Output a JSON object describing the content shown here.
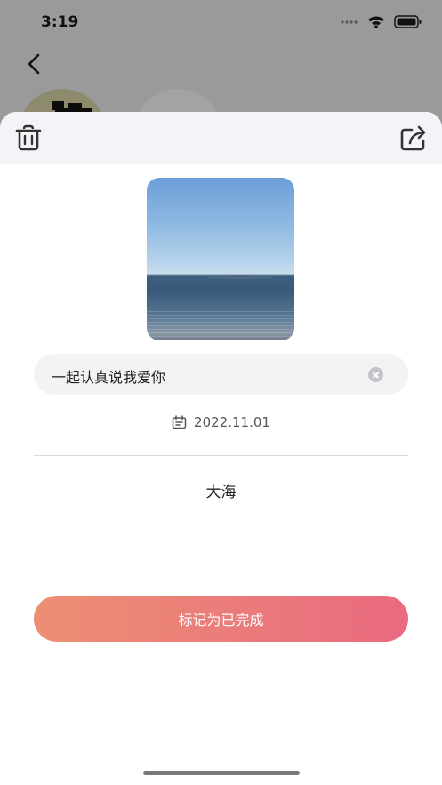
{
  "status_bar": {
    "time": "3:19"
  },
  "detail": {
    "title": "一起认真说我爱你",
    "date": "2022.11.01",
    "note": "大海",
    "complete_button": "标记为已完成"
  },
  "colors": {
    "button_gradient_start": "#ec8f74",
    "button_gradient_end": "#ea6a80",
    "sheet_header_bg": "#f4f4f8"
  },
  "icons": [
    "back-icon",
    "trash-icon",
    "share-icon",
    "calendar-icon",
    "clear-icon",
    "wifi-icon",
    "battery-icon",
    "signal-icon"
  ]
}
